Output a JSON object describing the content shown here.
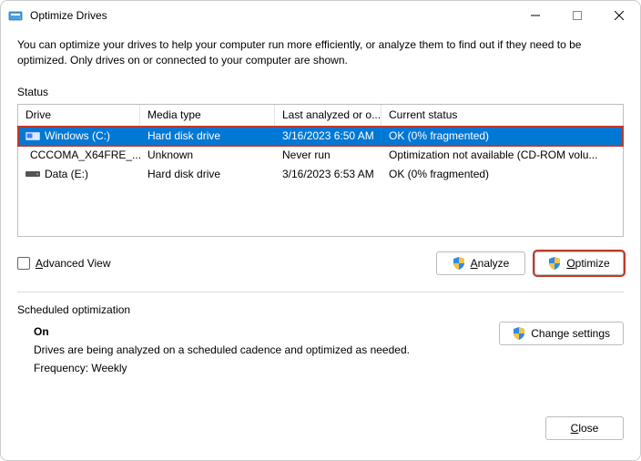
{
  "window": {
    "title": "Optimize Drives"
  },
  "intro": "You can optimize your drives to help your computer run more efficiently, or analyze them to find out if they need to be optimized. Only drives on or connected to your computer are shown.",
  "status_label": "Status",
  "columns": {
    "drive": "Drive",
    "media": "Media type",
    "last": "Last analyzed or o...",
    "status": "Current status"
  },
  "rows": [
    {
      "drive": "Windows (C:)",
      "media": "Hard disk drive",
      "last": "3/16/2023 6:50 AM",
      "status": "OK (0% fragmented)",
      "selected": true,
      "icon": "win"
    },
    {
      "drive": "CCCOMA_X64FRE_...",
      "media": "Unknown",
      "last": "Never run",
      "status": "Optimization not available (CD-ROM volu...",
      "selected": false,
      "icon": "cd"
    },
    {
      "drive": "Data (E:)",
      "media": "Hard disk drive",
      "last": "3/16/2023 6:53 AM",
      "status": "OK (0% fragmented)",
      "selected": false,
      "icon": "hdd"
    }
  ],
  "advanced_view": {
    "label": "Advanced View",
    "underline": "A"
  },
  "buttons": {
    "analyze": "Analyze",
    "optimize": "Optimize",
    "change": "Change settings",
    "close": "Close"
  },
  "scheduled": {
    "heading": "Scheduled optimization",
    "state": "On",
    "description": "Drives are being analyzed on a scheduled cadence and optimized as needed.",
    "frequency": "Frequency: Weekly"
  }
}
